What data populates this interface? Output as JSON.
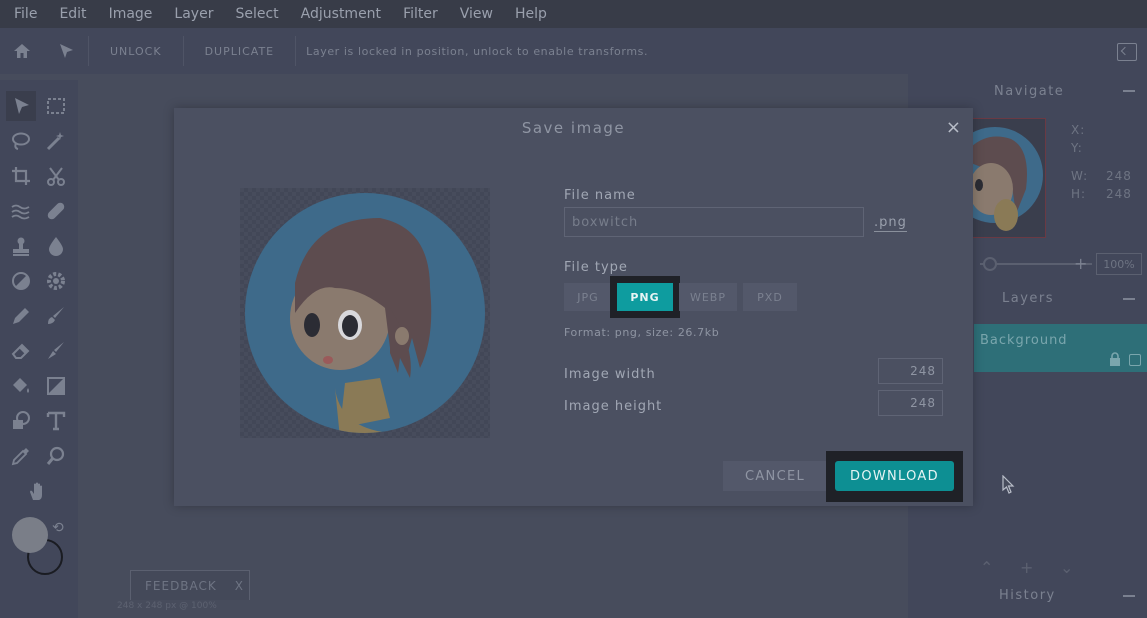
{
  "menubar": {
    "items": [
      "File",
      "Edit",
      "Image",
      "Layer",
      "Select",
      "Adjustment",
      "Filter",
      "View",
      "Help"
    ]
  },
  "optionsbar": {
    "unlock_label": "UNLOCK",
    "duplicate_label": "DUPLICATE",
    "hint": "Layer is locked in position, unlock to enable transforms."
  },
  "navigate": {
    "title": "Navigate",
    "x_label": "X:",
    "y_label": "Y:",
    "w_label": "W:",
    "w_value": "248",
    "h_label": "H:",
    "h_value": "248",
    "zoom": "100%"
  },
  "layers": {
    "title": "Layers",
    "items": [
      {
        "name": "Background"
      }
    ]
  },
  "history": {
    "title": "History"
  },
  "feedback": {
    "label": "FEEDBACK",
    "close": "X"
  },
  "statusbar": {
    "text": "248 x 248 px @ 100%"
  },
  "dialog": {
    "title": "Save image",
    "close": "×",
    "file_name_label": "File name",
    "file_name_value": "boxwitch",
    "extension": ".png",
    "file_type_label": "File type",
    "types": [
      "JPG",
      "PNG",
      "WEBP",
      "PXD"
    ],
    "selected_type": "PNG",
    "format_info": "Format: png, size: 26.7kb",
    "width_label": "Image width",
    "width_value": "248",
    "height_label": "Image height",
    "height_value": "248",
    "cancel_label": "CANCEL",
    "download_label": "DOWNLOAD"
  },
  "colors": {
    "accent": "#0e9c9f",
    "background": "#474c5c",
    "panel": "#42475a"
  }
}
